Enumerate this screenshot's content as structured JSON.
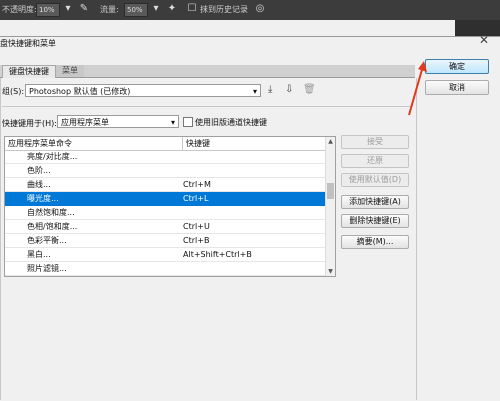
{
  "ps_toolbar": {
    "opacity_label": "不透明度:",
    "opacity_value": "10%",
    "flow_label": "流量:",
    "flow_value": "50%",
    "history_label": "抹到历史记录"
  },
  "dialog": {
    "title": "盘快捷键和菜单",
    "close": "✕",
    "ok_label": "确定",
    "cancel_label": "取消",
    "tabs": [
      {
        "label": "键盘快捷键"
      },
      {
        "label": "菜单"
      }
    ],
    "group_label": "组(S):",
    "group_value": "Photoshop 默认值 (已修改)",
    "shortcuts_for_label": "快捷键用于(H):",
    "shortcuts_for_value": "应用程序菜单",
    "legacy_checkbox_label": "使用旧版通道快捷键",
    "table": {
      "col1": "应用程序菜单命令",
      "col2": "快捷键",
      "rows": [
        {
          "cmd": "亮度/对比度...",
          "key": ""
        },
        {
          "cmd": "色阶...",
          "key": ""
        },
        {
          "cmd": "曲线...",
          "key": "Ctrl+M"
        },
        {
          "cmd": "曝光度...",
          "key": "Ctrl+L"
        },
        {
          "cmd": "自然饱和度...",
          "key": ""
        },
        {
          "cmd": "色相/饱和度...",
          "key": "Ctrl+U"
        },
        {
          "cmd": "色彩平衡...",
          "key": "Ctrl+B"
        },
        {
          "cmd": "黑白...",
          "key": "Alt+Shift+Ctrl+B"
        },
        {
          "cmd": "照片滤镜...",
          "key": ""
        }
      ]
    },
    "side_buttons": {
      "accept": "接受",
      "undo": "还原",
      "use_default": "使用默认值(D)",
      "add_shortcut": "添加快捷键(A)",
      "delete_shortcut": "删除快捷键(E)",
      "summary": "摘要(M)..."
    }
  },
  "colors": {
    "selection": "#0078d7",
    "annotation_arrow": "#e03a1e"
  }
}
